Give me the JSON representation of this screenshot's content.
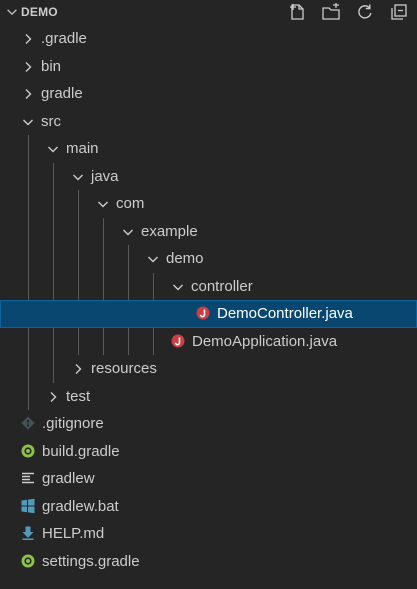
{
  "explorer": {
    "section_title": "DEMO",
    "actions": [
      {
        "name": "new-file-button",
        "icon": "new-file-icon"
      },
      {
        "name": "new-folder-button",
        "icon": "new-folder-icon"
      },
      {
        "name": "refresh-button",
        "icon": "refresh-icon"
      },
      {
        "name": "collapse-all-button",
        "icon": "collapse-all-icon"
      }
    ]
  },
  "tree": {
    "items": [
      {
        "label": ".gradle",
        "type": "folder",
        "expanded": false,
        "depth": 0
      },
      {
        "label": "bin",
        "type": "folder",
        "expanded": false,
        "depth": 0
      },
      {
        "label": "gradle",
        "type": "folder",
        "expanded": false,
        "depth": 0
      },
      {
        "label": "src",
        "type": "folder",
        "expanded": true,
        "depth": 0
      },
      {
        "label": "main",
        "type": "folder",
        "expanded": true,
        "depth": 1
      },
      {
        "label": "java",
        "type": "folder",
        "expanded": true,
        "depth": 2
      },
      {
        "label": "com",
        "type": "folder",
        "expanded": true,
        "depth": 3
      },
      {
        "label": "example",
        "type": "folder",
        "expanded": true,
        "depth": 4
      },
      {
        "label": "demo",
        "type": "folder",
        "expanded": true,
        "depth": 5
      },
      {
        "label": "controller",
        "type": "folder",
        "expanded": true,
        "depth": 6
      },
      {
        "label": "DemoController.java",
        "type": "file",
        "icon": "java-icon",
        "depth": 7,
        "selected": true
      },
      {
        "label": "DemoApplication.java",
        "type": "file",
        "icon": "java-icon",
        "depth": 6
      },
      {
        "label": "resources",
        "type": "folder",
        "expanded": false,
        "depth": 2
      },
      {
        "label": "test",
        "type": "folder",
        "expanded": false,
        "depth": 1
      },
      {
        "label": ".gitignore",
        "type": "file",
        "icon": "git-icon",
        "depth": 0
      },
      {
        "label": "build.gradle",
        "type": "file",
        "icon": "gradle-icon",
        "depth": 0
      },
      {
        "label": "gradlew",
        "type": "file",
        "icon": "text-lines-icon",
        "depth": 0
      },
      {
        "label": "gradlew.bat",
        "type": "file",
        "icon": "windows-icon",
        "depth": 0
      },
      {
        "label": "HELP.md",
        "type": "file",
        "icon": "markdown-download-icon",
        "depth": 0
      },
      {
        "label": "settings.gradle",
        "type": "file",
        "icon": "gradle-icon",
        "depth": 0
      }
    ]
  },
  "colors": {
    "background": "#252526",
    "selection": "#094771",
    "text": "#cccccc",
    "java": "#cc3e44",
    "gradle": "#8dc149",
    "windows": "#519aba",
    "git": "#41535b"
  }
}
